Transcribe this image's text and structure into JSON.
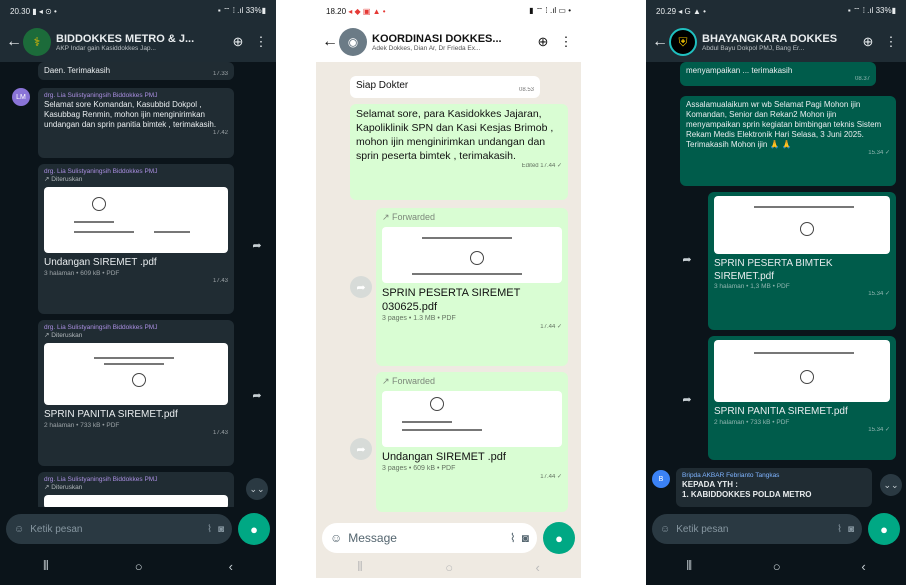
{
  "phone1": {
    "status_time": "20.30",
    "status_icons": "▮ ◂ ⊙ •",
    "status_right": "▪ ⌔ ⁞ .ıl 33%▮",
    "title": "BIDDOKKES METRO & J...",
    "subtitle": "AKP Indar gain Kasiddokkes Jap...",
    "top_snippet": "Daen. Terimakasih",
    "top_time": "17.33",
    "msg1_sender": "drg. Lia Sulistyaningsih Biddokkes PMJ",
    "msg1_text": "Selamat sore Komandan, Kasubbid Dokpol , Kasubbag Renmin, mohon ijin menginirimkan undangan dan sprin panitia bimtek , terimakasih.",
    "msg1_time": "17.42",
    "msg2_sender": "drg. Lia Sulistyaningsih Biddokkes PMJ",
    "msg2_fwd": "↗ Diteruskan",
    "msg2_file": "Undangan SIREMET .pdf",
    "msg2_meta": "3 halaman • 609 kB • PDF",
    "msg2_time": "17.43",
    "msg3_sender": "drg. Lia Sulistyaningsih Biddokkes PMJ",
    "msg3_fwd": "↗ Diteruskan",
    "msg3_file": "SPRIN PANITIA SIREMET.pdf",
    "msg3_meta": "2 halaman • 733 kB • PDF",
    "msg3_time": "17.43",
    "msg4_sender": "drg. Lia Sulistyaningsih Biddokkes PMJ",
    "msg4_fwd": "↗ Diteruskan",
    "input_placeholder": "Ketik pesan"
  },
  "phone2": {
    "status_time": "18.20",
    "status_right": "▮ ⌔ ⁞ .ıl ▭ •",
    "title": "KOORDINASI DOKKES...",
    "subtitle": "Adek Dokkes, Dian Ar, Dr Frieda Ex...",
    "msg0_text": "Siap Dokter",
    "msg0_time": "08.53",
    "msg1_text": "Selamat sore, para Kasidokkes Jajaran, Kapoliklinik SPN dan Kasi Kesjas Brimob , mohon ijin menginirimkan undangan dan sprin peserta bimtek , terimakasih.",
    "msg1_time": "Edited 17.44 ✓",
    "msg2_fwd": "↗ Forwarded",
    "msg2_file": "SPRIN PESERTA SIREMET 030625.pdf",
    "msg2_meta": "3 pages • 1.3 MB • PDF",
    "msg2_time": "17.44 ✓",
    "msg3_fwd": "↗ Forwarded",
    "msg3_file": "Undangan SIREMET .pdf",
    "msg3_meta": "3 pages • 609 kB • PDF",
    "msg3_time": "17.44 ✓",
    "input_placeholder": "Message"
  },
  "phone3": {
    "status_time": "20.29",
    "status_icons": "◂ G ▲ •",
    "status_right": "▪ ⌔ ⁞ .ıl 33%▮",
    "title": "BHAYANGKARA DOKKES",
    "subtitle": "Abdul Bayu Dokpol PMJ, Bang Er...",
    "top_snippet": "menyampaikan ... terimakasih",
    "top_time": "08.37",
    "msg1_text": "Assalamualaikum wr wb Selamat Pagi Mohon ijin Komandan, Senior dan Rekan2 Mohon ijin menyampaikan sprin kegiatan bimbingan teknis Sistem Rekam Medis Elektronik Hari Selasa, 3 Juni 2025. Terimakasih Mohon ijin 🙏 🙏",
    "msg1_time": "15.34 ✓",
    "msg2_file": "SPRIN PESERTA BIMTEK SIREMET.pdf",
    "msg2_meta": "3 halaman • 1,3 MB • PDF",
    "msg2_time": "15.34 ✓",
    "msg3_file": "SPRIN PANITIA SIREMET.pdf",
    "msg3_meta": "2 halaman • 733 kB • PDF",
    "msg3_time": "15.34 ✓",
    "msg4_sender": "Bripda AKBAR Febrianto Tangkas",
    "msg4_text": "KEPADA YTH :\n1. KABIDDOKKES POLDA METRO",
    "input_placeholder": "Ketik pesan"
  },
  "colors": {
    "accent": "#00a884",
    "out_dark": "#005c4b",
    "out_light": "#d9fdd3",
    "in_dark": "#202c33"
  },
  "icons": [
    "back-arrow-icon",
    "video-call-icon",
    "more-vert-icon",
    "share-forward-icon",
    "attach-icon",
    "camera-icon",
    "mic-icon",
    "sticker-icon",
    "nav-recents-icon",
    "nav-home-icon",
    "nav-back-icon"
  ]
}
